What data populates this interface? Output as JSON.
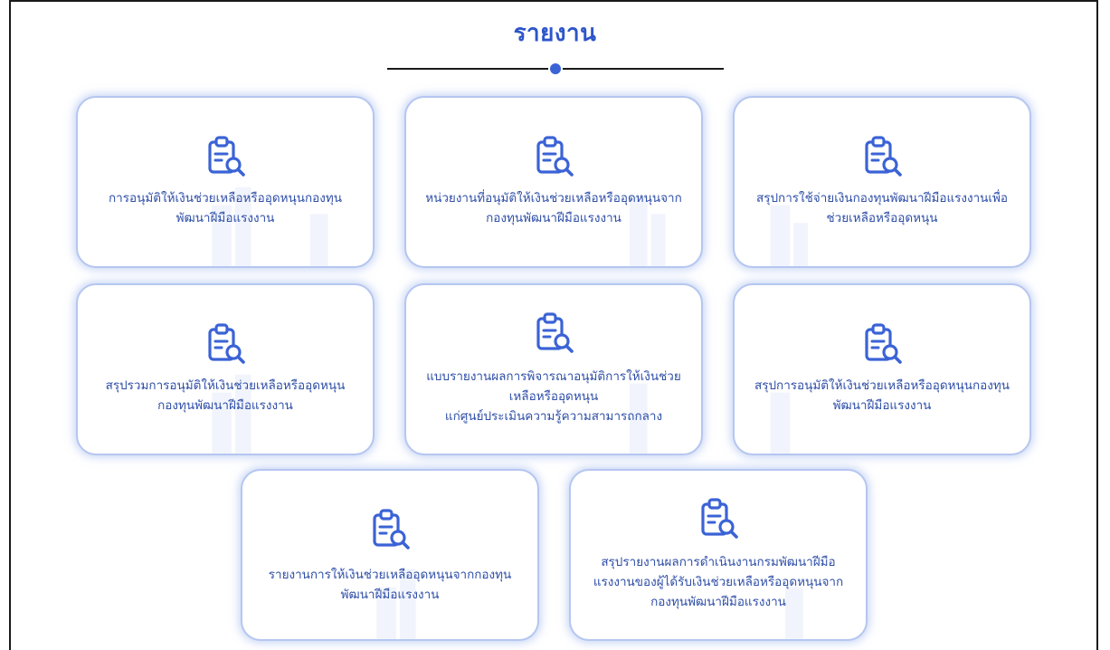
{
  "page": {
    "title": "รายงาน",
    "accent_color": "#2e56c9",
    "card_border_color": "#b5c6f0",
    "icon_name": "clipboard-search-icon"
  },
  "cards": [
    {
      "label": "การอนุมัติให้เงินช่วยเหลือหรืออุดหนุนกองทุน\nพัฒนาฝีมือแรงงาน"
    },
    {
      "label": "หน่วยงานที่อนุมัติให้เงินช่วยเหลือหรืออุดหนุนจาก\nกองทุนพัฒนาฝีมือแรงงาน"
    },
    {
      "label": "สรุปการใช้จ่ายเงินกองทุนพัฒนาฝีมือแรงงานเพื่อ\nช่วยเหลือหรืออุดหนุน"
    },
    {
      "label": "สรุปรวมการอนุมัติให้เงินช่วยเหลือหรืออุดหนุน\nกองทุนพัฒนาฝีมือแรงงาน"
    },
    {
      "label": "แบบรายงานผลการพิจารณาอนุมัติการให้เงินช่วย\nเหลือหรืออุดหนุน\nแก่ศูนย์ประเมินความรู้ความสามารถกลาง"
    },
    {
      "label": "สรุปการอนุมัติให้เงินช่วยเหลือหรืออุดหนุนกองทุน\nพัฒนาฝีมือแรงงาน"
    },
    {
      "label": "รายงานการให้เงินช่วยเหลืออุดหนุนจากกองทุน\nพัฒนาฝีมือแรงงาน"
    },
    {
      "label": "สรุปรายงานผลการดำเนินงานกรมพัฒนาฝีมือ\nแรงงานของผู้ได้รับเงินช่วยเหลือหรืออุดหนุนจาก\nกองทุนพัฒนาฝีมือแรงงาน"
    }
  ]
}
